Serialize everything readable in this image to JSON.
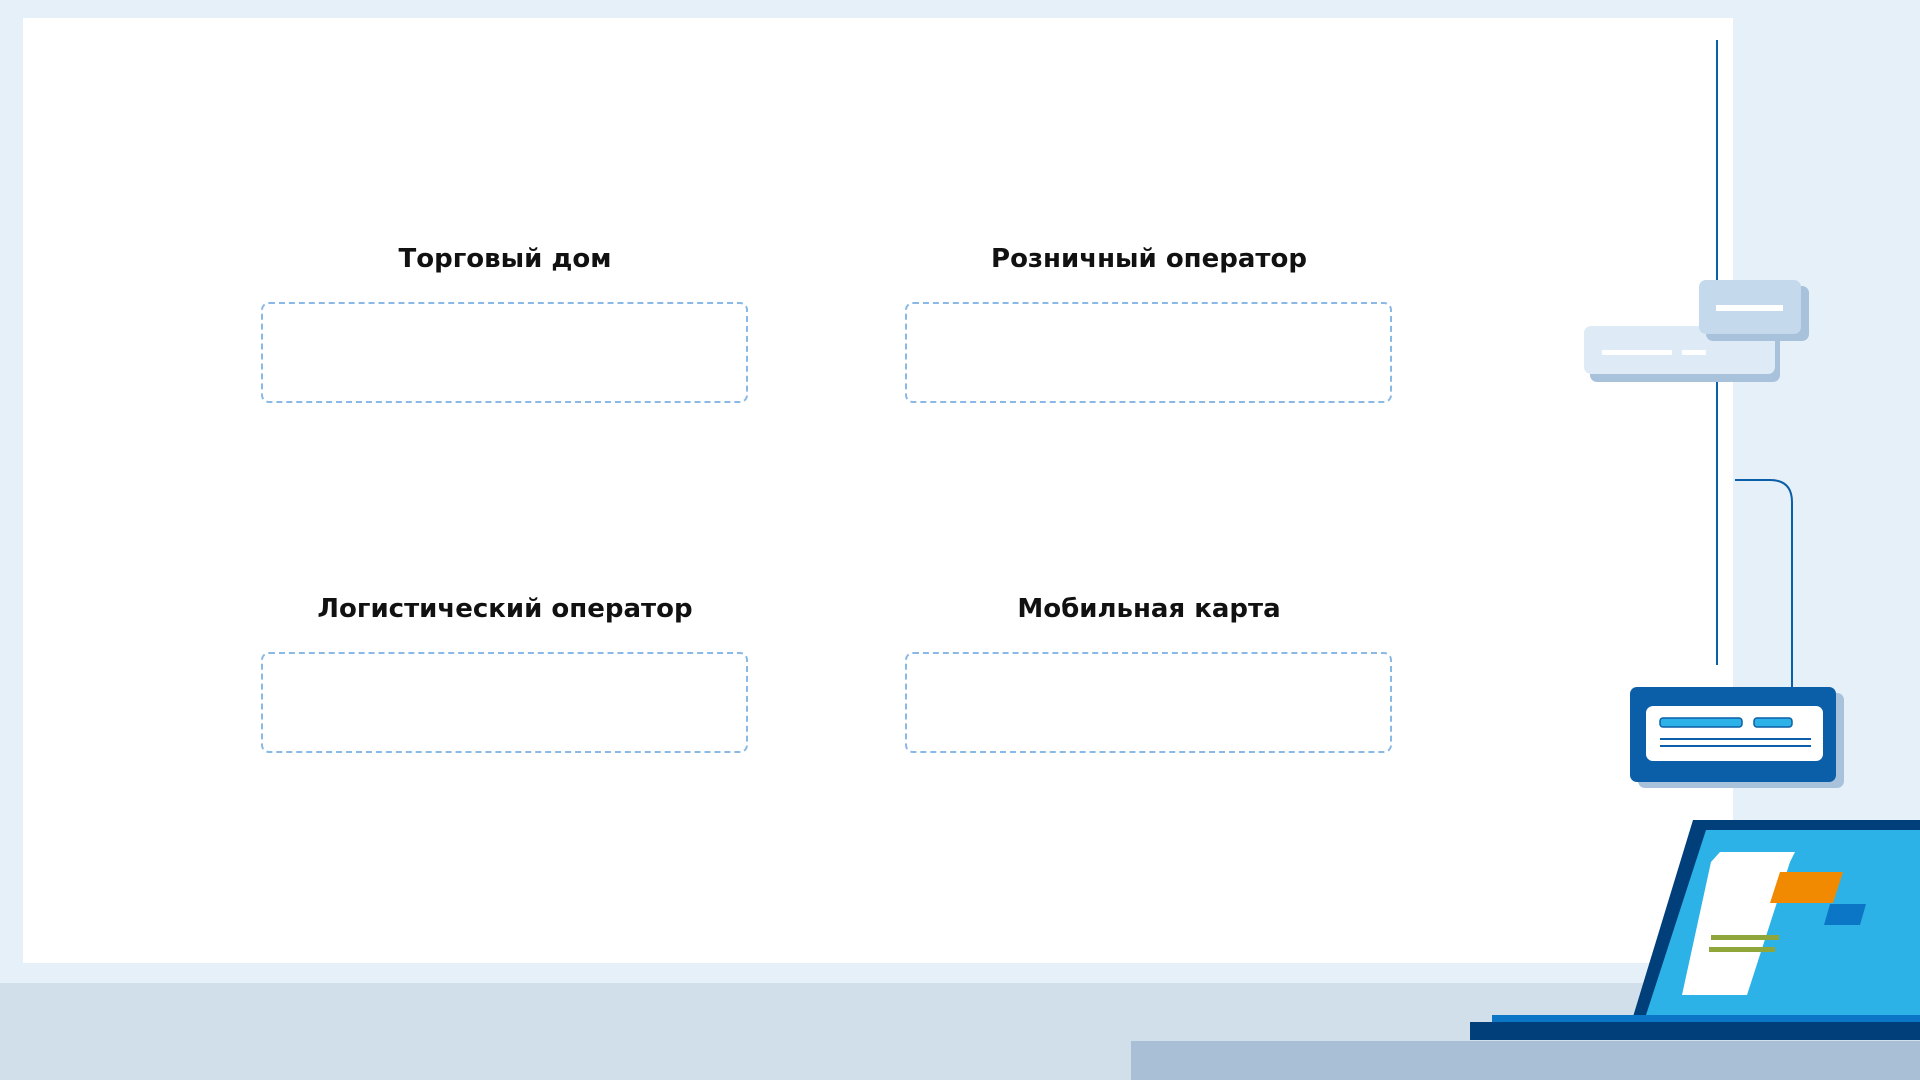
{
  "slots": [
    {
      "label": "Торговый дом"
    },
    {
      "label": "Розничный оператор"
    },
    {
      "label": "Логистический оператор"
    },
    {
      "label": "Мобильная карта"
    }
  ],
  "colors": {
    "background": "#e6f0f9",
    "whiteboard": "#ffffff",
    "slot_border": "#8ab9e6",
    "accent_blue": "#2db2e8",
    "dark_blue": "#0b5ea8",
    "navy": "#003f7a",
    "orange": "#f18a00",
    "green": "#8fa63b"
  },
  "icons": [
    "chat-bubbles-icon",
    "server-device-icon",
    "laptop-icon"
  ]
}
